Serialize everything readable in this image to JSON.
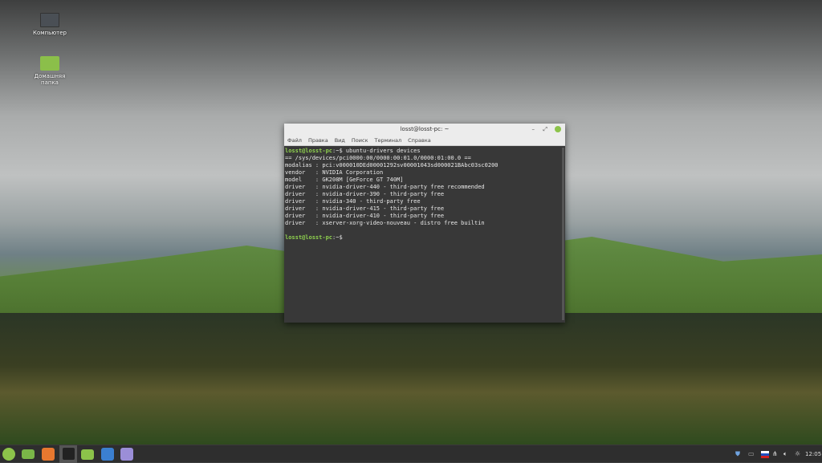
{
  "desktop": {
    "icons": [
      {
        "label": "Компьютер"
      },
      {
        "label": "Домашняя папка"
      }
    ]
  },
  "terminal": {
    "title": "losst@losst-pc: ~",
    "menu": [
      "Файл",
      "Правка",
      "Вид",
      "Поиск",
      "Терминал",
      "Справка"
    ],
    "prompt": "losst@losst-pc",
    "prompt_suffix": ":~$",
    "command": " ubuntu-drivers devices",
    "output": [
      "== /sys/devices/pci0000:00/0000:00:01.0/0000:01:00.0 ==",
      "modalias : pci:v000010DEd00001292sv00001043sd000021BAbc03sc0200",
      "vendor   : NVIDIA Corporation",
      "model    : GK208M [GeForce GT 740M]",
      "driver   : nvidia-driver-440 - third-party free recommended",
      "driver   : nvidia-driver-390 - third-party free",
      "driver   : nvidia-340 - third-party free",
      "driver   : nvidia-driver-415 - third-party free",
      "driver   : nvidia-driver-410 - third-party free",
      "driver   : xserver-xorg-video-nouveau - distro free builtin"
    ]
  },
  "taskbar": {
    "clock": "12:05",
    "accent": "#8cc34a"
  }
}
